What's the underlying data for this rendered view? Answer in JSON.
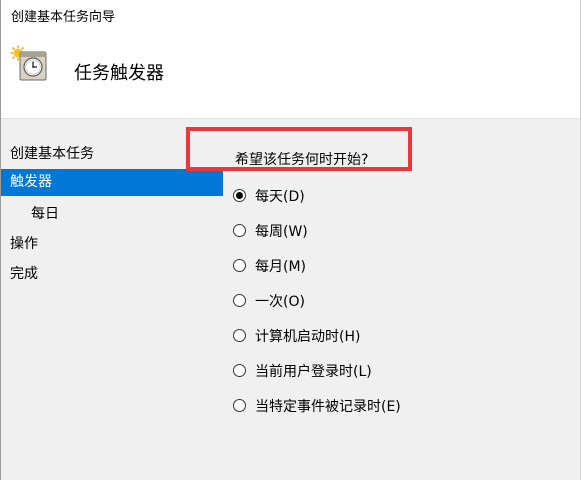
{
  "window": {
    "title": "创建基本任务向导"
  },
  "header": {
    "title": "任务触发器",
    "icon": "task-scheduler-clock-icon"
  },
  "nav": {
    "items": [
      {
        "label": "创建基本任务"
      },
      {
        "label": "触发器",
        "selected": true
      },
      {
        "label": "每日"
      },
      {
        "label": "操作"
      },
      {
        "label": "完成"
      }
    ]
  },
  "trigger": {
    "question": "希望该任务何时开始?",
    "options": [
      {
        "label": "每天(D)",
        "checked": true
      },
      {
        "label": "每周(W)",
        "checked": false
      },
      {
        "label": "每月(M)",
        "checked": false
      },
      {
        "label": "一次(O)",
        "checked": false
      },
      {
        "label": "计算机启动时(H)",
        "checked": false
      },
      {
        "label": "当前用户登录时(L)",
        "checked": false
      },
      {
        "label": "当特定事件被记录时(E)",
        "checked": false
      }
    ]
  },
  "colors": {
    "selection": "#0078d7",
    "highlight_box": "#e8383d",
    "panel_background": "#f0f0f0"
  }
}
